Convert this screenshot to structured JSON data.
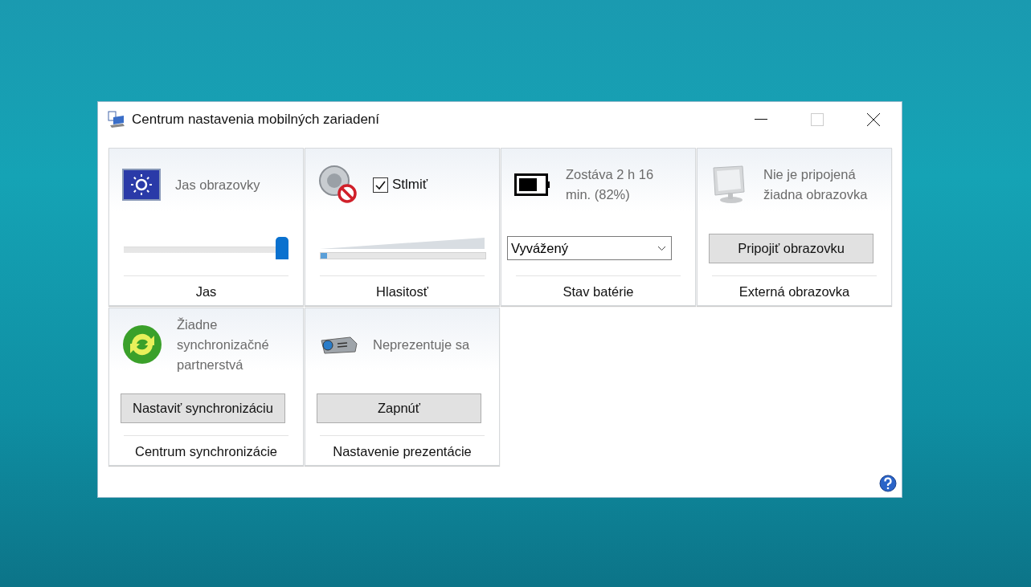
{
  "window": {
    "title": "Centrum nastavenia mobilných zariadení"
  },
  "tiles": [
    {
      "kind": "slider",
      "status": "Jas obrazovky",
      "level": 1,
      "caption": "Jas"
    },
    {
      "kind": "volume",
      "checkbox": {
        "label": "Stlmiť",
        "checked": true
      },
      "level": 0.04,
      "caption": "Hlasitosť"
    },
    {
      "kind": "select",
      "status": "Zostáva 2 h 16 min. (82%)",
      "value": "Vyvážený",
      "caption": "Stav batérie"
    },
    {
      "kind": "button",
      "status": "Nie je pripojená žiadna obrazovka",
      "button": "Pripojiť obrazovku",
      "caption": "Externá obrazovka"
    },
    {
      "kind": "button",
      "status": "Žiadne synchronizačné partnerstvá",
      "button": "Nastaviť synchronizáciu",
      "caption": "Centrum synchronizácie"
    },
    {
      "kind": "button",
      "status": "Neprezentuje sa",
      "button": "Zapnúť",
      "caption": "Nastavenie prezentácie"
    }
  ]
}
